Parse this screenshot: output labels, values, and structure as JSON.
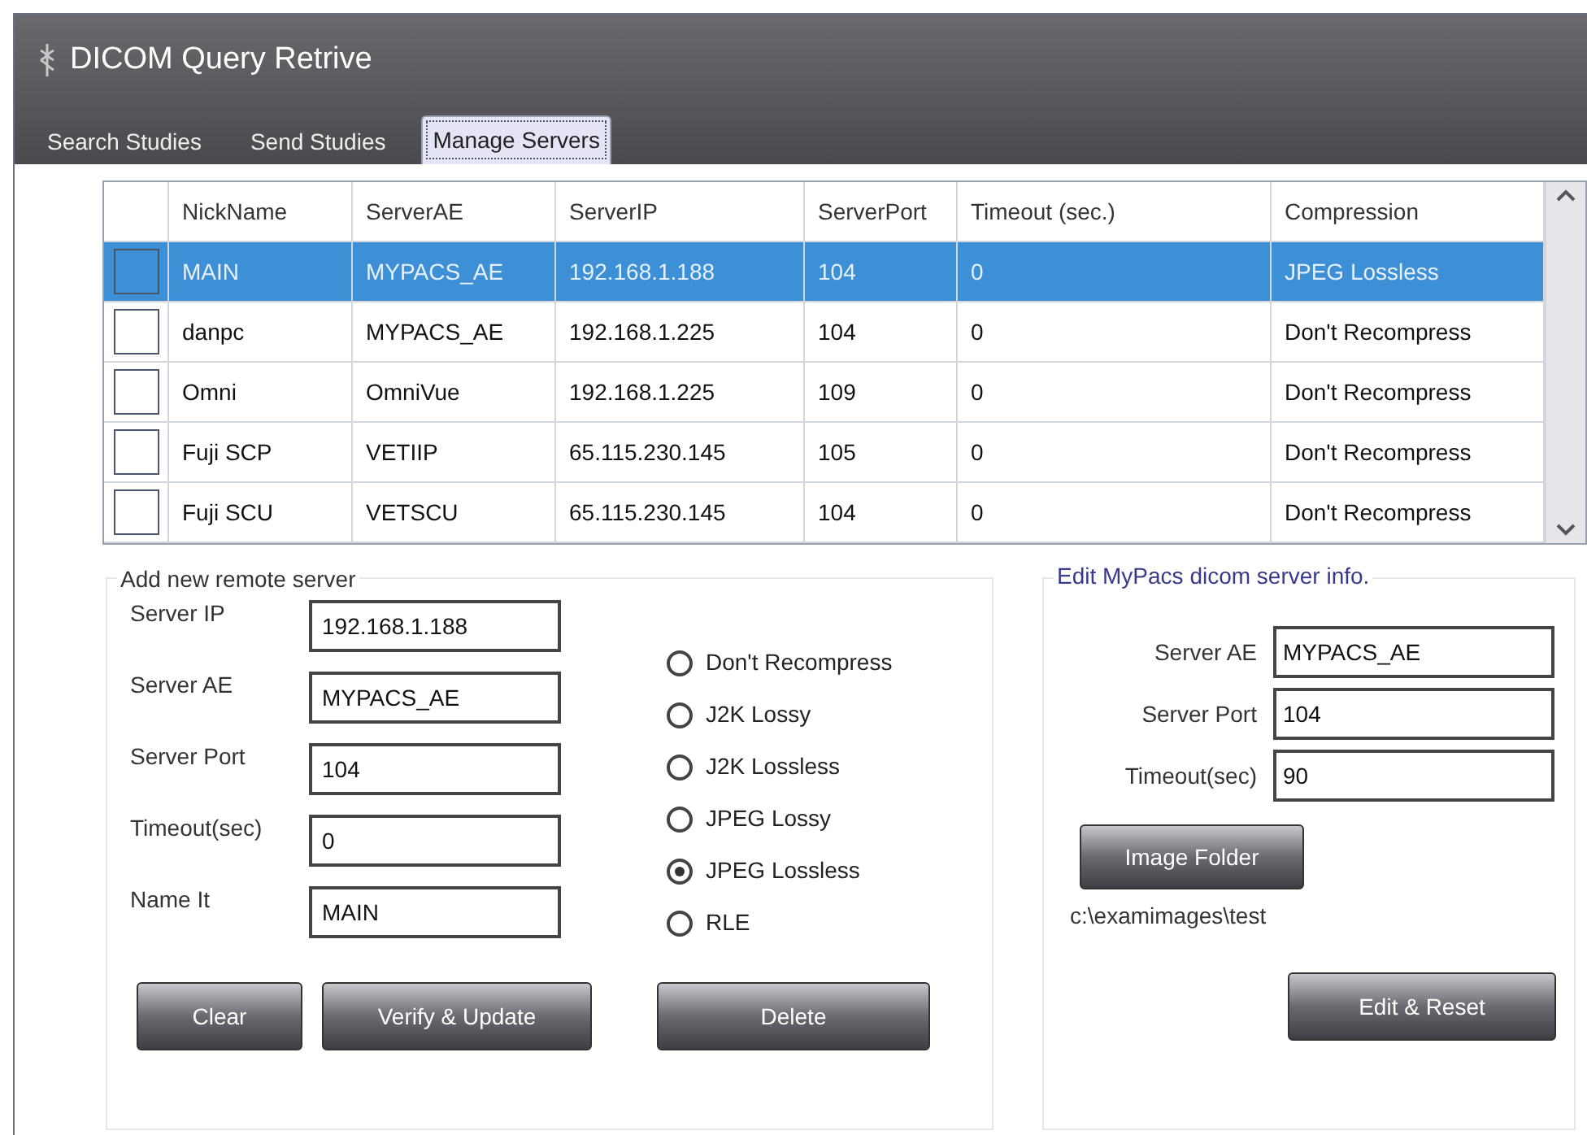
{
  "window": {
    "title": "DICOM Query Retrive"
  },
  "tabs": [
    {
      "label": "Search Studies",
      "selected": false
    },
    {
      "label": "Send Studies",
      "selected": false
    },
    {
      "label": "Manage Servers",
      "selected": true
    }
  ],
  "servers_table": {
    "columns": [
      "NickName",
      "ServerAE",
      "ServerIP",
      "ServerPort",
      "Timeout (sec.)",
      "Compression"
    ],
    "rows": [
      {
        "selected": true,
        "cells": [
          "MAIN",
          "MYPACS_AE",
          "192.168.1.188",
          "104",
          "0",
          "JPEG Lossless"
        ]
      },
      {
        "selected": false,
        "cells": [
          "danpc",
          "MYPACS_AE",
          "192.168.1.225",
          "104",
          "0",
          "Don't Recompress"
        ]
      },
      {
        "selected": false,
        "cells": [
          "Omni",
          "OmniVue",
          "192.168.1.225",
          "109",
          "0",
          "Don't Recompress"
        ]
      },
      {
        "selected": false,
        "cells": [
          "Fuji SCP",
          "VETIIP",
          "65.115.230.145",
          "105",
          "0",
          "Don't Recompress"
        ]
      },
      {
        "selected": false,
        "cells": [
          "Fuji SCU",
          "VETSCU",
          "65.115.230.145",
          "104",
          "0",
          "Don't Recompress"
        ]
      }
    ]
  },
  "add_server": {
    "title": "Add new remote server",
    "fields": [
      {
        "label": "Server IP",
        "value": "192.168.1.188"
      },
      {
        "label": "Server AE",
        "value": "MYPACS_AE"
      },
      {
        "label": "Server Port",
        "value": "104"
      },
      {
        "label": "Timeout(sec)",
        "value": "0"
      },
      {
        "label": "Name It",
        "value": "MAIN"
      }
    ],
    "compression": [
      {
        "label": "Don't Recompress",
        "selected": false
      },
      {
        "label": "J2K Lossy",
        "selected": false
      },
      {
        "label": "J2K Lossless",
        "selected": false
      },
      {
        "label": "JPEG Lossy",
        "selected": false
      },
      {
        "label": "JPEG Lossless",
        "selected": true
      },
      {
        "label": "RLE",
        "selected": false
      }
    ],
    "buttons": [
      "Clear",
      "Verify & Update",
      "Delete"
    ]
  },
  "edit_server": {
    "title": "Edit MyPacs dicom server info.",
    "fields": [
      {
        "label": "Server AE",
        "value": "MYPACS_AE"
      },
      {
        "label": "Server Port",
        "value": "104"
      },
      {
        "label": "Timeout(sec)",
        "value": "90"
      }
    ],
    "folder_button": "Image Folder",
    "folder_path": "c:\\examimages\\test",
    "button": "Edit & Reset"
  }
}
